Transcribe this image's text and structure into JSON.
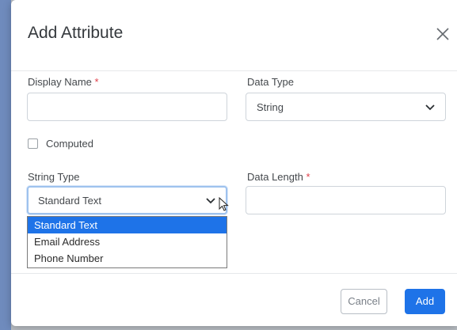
{
  "modal": {
    "title": "Add Attribute"
  },
  "form": {
    "display_name": {
      "label": "Display Name",
      "required_mark": "*",
      "value": ""
    },
    "data_type": {
      "label": "Data Type",
      "selected": "String"
    },
    "computed": {
      "label": "Computed",
      "checked": false
    },
    "string_type": {
      "label": "String Type",
      "selected": "Standard Text",
      "options": [
        "Standard Text",
        "Email Address",
        "Phone Number"
      ],
      "highlighted_index": 0
    },
    "data_length": {
      "label": "Data Length",
      "required_mark": "*",
      "value": ""
    }
  },
  "footer": {
    "cancel_label": "Cancel",
    "add_label": "Add"
  },
  "colors": {
    "primary": "#1e73e8",
    "required": "#e0404a",
    "focus_border": "#9ec2ee"
  },
  "icons": [
    "close-icon",
    "chevron-down-icon",
    "mouse-cursor-icon"
  ]
}
